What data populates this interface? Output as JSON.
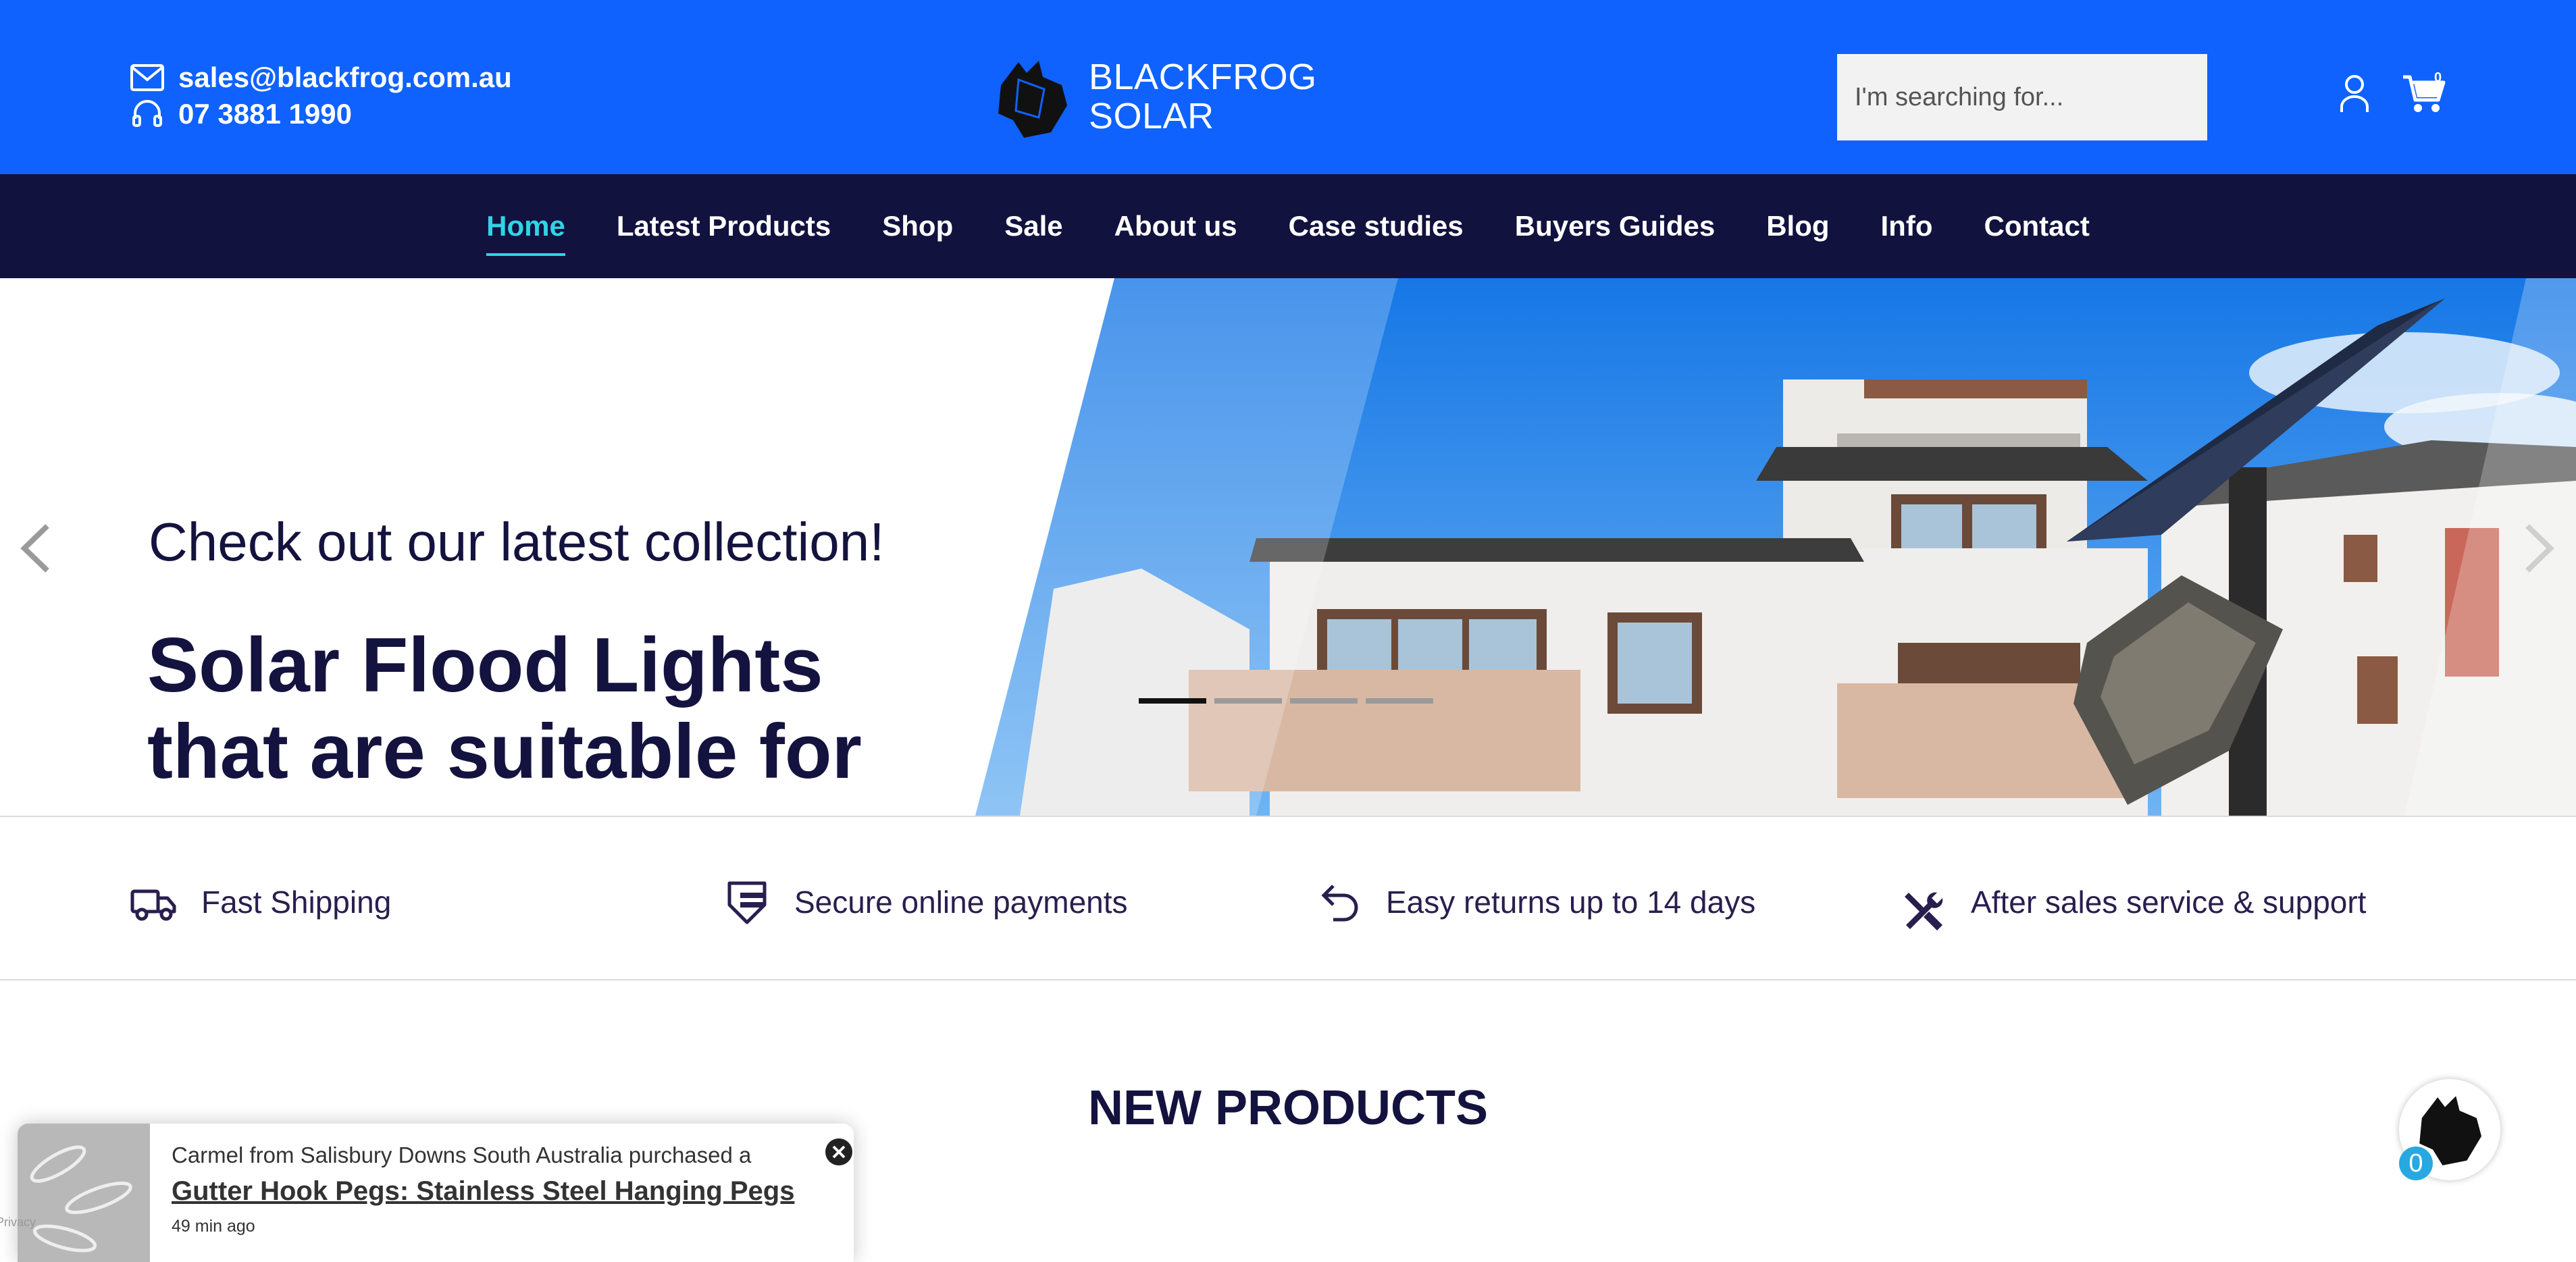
{
  "header": {
    "email": "sales@blackfrog.com.au",
    "phone": "07 3881 1990",
    "logo_line1": "BLACKFROG",
    "logo_line2": "SOLAR",
    "search_placeholder": "I'm searching for...",
    "cart_count": "0",
    "colors": {
      "header_bg": "#0f62fe",
      "nav_bg": "#12123f",
      "active_nav": "#2fd5e6"
    }
  },
  "nav": {
    "items": [
      {
        "label": "Home",
        "active": true
      },
      {
        "label": "Latest Products"
      },
      {
        "label": "Shop"
      },
      {
        "label": "Sale"
      },
      {
        "label": "About us"
      },
      {
        "label": "Case studies"
      },
      {
        "label": "Buyers Guides"
      },
      {
        "label": "Blog"
      },
      {
        "label": "Info"
      },
      {
        "label": "Contact"
      }
    ]
  },
  "hero": {
    "subtitle": "Check out our latest collection!",
    "title_line1": "Solar Flood Lights",
    "title_line2": "that are suitable for",
    "active_slide": 1,
    "slide_count": 4
  },
  "features": [
    {
      "icon": "truck-icon",
      "label": "Fast Shipping"
    },
    {
      "icon": "card-icon",
      "label": "Secure online payments"
    },
    {
      "icon": "return-icon",
      "label": "Easy returns up to 14 days"
    },
    {
      "icon": "tools-icon",
      "label": "After sales service & support"
    }
  ],
  "new_products": {
    "title": "NEW PRODUCTS"
  },
  "popup": {
    "message": "Carmel from Salisbury Downs South Australia purchased a",
    "product": "Gutter Hook Pegs: Stainless Steel Hanging Pegs",
    "time": "49 min ago"
  },
  "privacy": "Privacy",
  "floating_badge": {
    "count": "0"
  }
}
